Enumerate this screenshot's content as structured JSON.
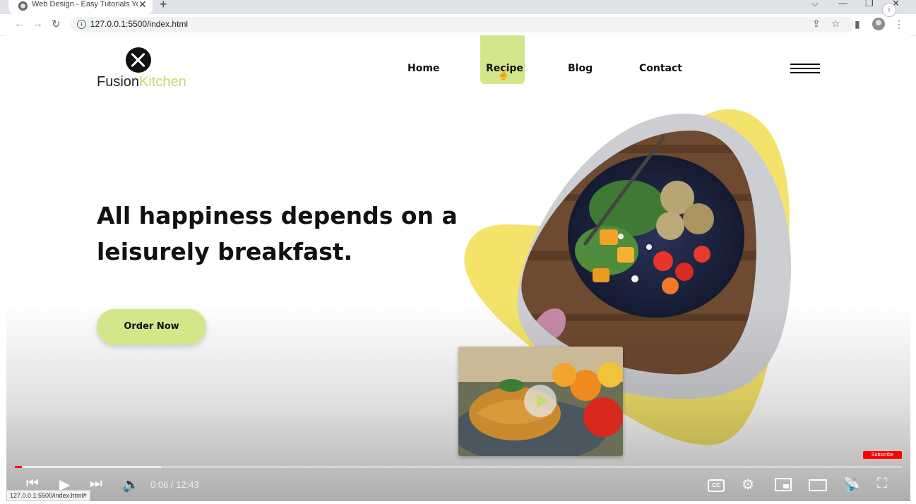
{
  "browser": {
    "tab_title": "Web Design - Easy Tutorials YouT",
    "tab_close": "✕",
    "new_tab": "+",
    "url": "127.0.0.1:5500/index.html",
    "status_url": "127.0.0.1:5500/index.html#"
  },
  "site": {
    "logo_part1": "Fusion",
    "logo_part2": "Kitchen",
    "nav": [
      "Home",
      "Recipe",
      "Blog",
      "Contact"
    ],
    "headline": "All happiness depends on a leisurely breakfast.",
    "cta": "Order Now"
  },
  "player": {
    "time": "0:06 / 12:43",
    "subscribe": "Subscribe",
    "cc": "CC",
    "progress_played": 0.008,
    "progress_loaded": 0.165
  },
  "colors": {
    "accent": "#d3e78a",
    "blob": "#f4e36a",
    "progress": "#ff0000"
  }
}
